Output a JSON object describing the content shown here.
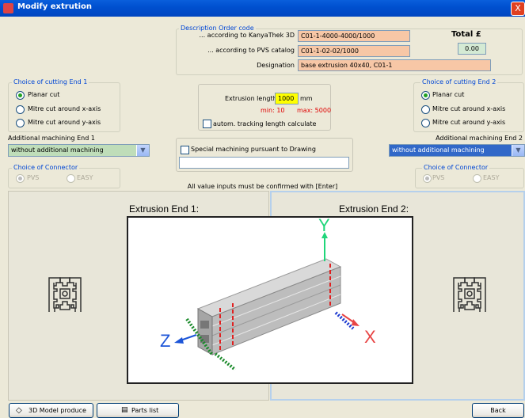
{
  "window": {
    "title": "Modify extrution",
    "close_glyph": "X"
  },
  "description": {
    "legend": "Description Order code",
    "kanya_label": "... according to KanyaThek 3D",
    "kanya_value": "C01-1-4000-4000/1000",
    "pvs_label": "... according to PVS catalog",
    "pvs_value": "C01-1-02-02/1000",
    "designation_label": "Designation",
    "designation_value": "base extrusion 40x40, C01-1"
  },
  "total": {
    "label": "Total £",
    "value": "0.00"
  },
  "cutting_end1": {
    "legend": "Choice of cutting End 1",
    "options": [
      "Planar cut",
      "Mitre cut around x-axis",
      "Mitre cut around y-axis"
    ],
    "selected": 0
  },
  "cutting_end2": {
    "legend": "Choice of cutting End 2",
    "options": [
      "Planar cut",
      "Mitre cut around x-axis",
      "Mitre cut around y-axis"
    ],
    "selected": 0
  },
  "length": {
    "label": "Extrusion length",
    "value": "1000",
    "unit": "mm",
    "min": "min: 10",
    "max": "max: 5000",
    "tracking_label": "autom. tracking length calculate",
    "tracking_checked": false
  },
  "machining_end1": {
    "label": "Additional machining End 1",
    "value": "without additional machining"
  },
  "machining_end2": {
    "label": "Additional machining End 2",
    "value": "without additional machining"
  },
  "special": {
    "label": "Special machining pursuant to Drawing",
    "checked": false,
    "text": ""
  },
  "connector1": {
    "legend": "Choice of Connector",
    "options": [
      "PVS",
      "EASY"
    ],
    "selected": 0
  },
  "connector2": {
    "legend": "Choice of Connector",
    "options": [
      "PVS",
      "EASY"
    ],
    "selected": 0
  },
  "hint": "All value inputs must be confirmed with [Enter]",
  "panels": {
    "end1_title": "Extrusion End 1:",
    "end2_title": "Extrusion End 2:"
  },
  "axes": {
    "x": "X",
    "y": "Y",
    "z": "Z"
  },
  "colors": {
    "axis_x": "#e84545",
    "axis_y": "#1fd67a",
    "axis_z": "#1c55d8",
    "field_bg": "#f7c7a6",
    "highlight": "#ffff00",
    "limit_text": "#e00000",
    "legend_blue": "#0046d5"
  },
  "buttons": {
    "model": "3D Model produce",
    "parts": "Parts list",
    "back": "Back"
  },
  "icons": {
    "model": "cube-icon",
    "parts": "list-icon",
    "profile": "extrusion-profile-icon"
  }
}
